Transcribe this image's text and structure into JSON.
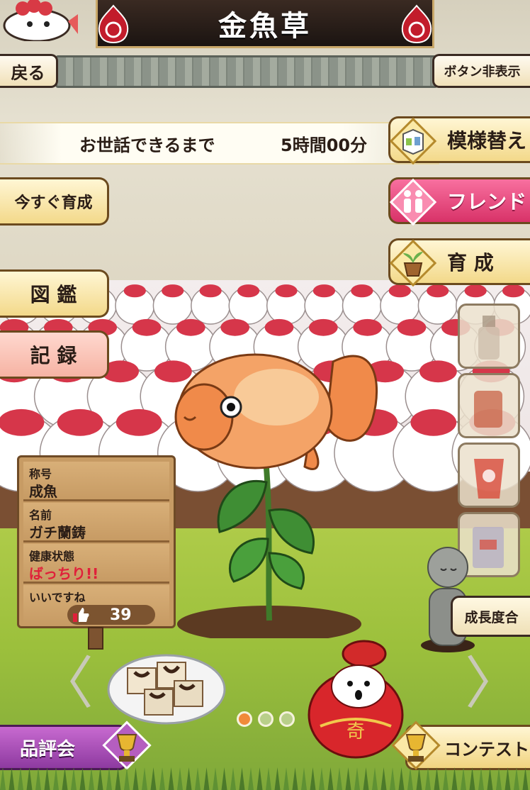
{
  "header": {
    "title": "金魚草"
  },
  "nav": {
    "back_label": "戻る",
    "hide_buttons_label": "ボタン非表示"
  },
  "timer": {
    "label": "お世話できるまで",
    "value": "5時間00分"
  },
  "right_menu": {
    "pattern_label": "模様替え",
    "friend_label": "フレンド",
    "grow_label": "育 成"
  },
  "left_menu": {
    "grow_now_label": "今すぐ育成",
    "encyclopedia_label": "図 鑑",
    "record_label": "記 録"
  },
  "growth_level_label": "成長度合",
  "info_sign": {
    "title_label": "称号",
    "title_value": "成魚",
    "name_label": "名前",
    "name_value": "ガチ蘭鋳",
    "health_label": "健康状態",
    "health_value": "ばっちり!!",
    "likes_label": "いいですね",
    "likes_count": "39"
  },
  "carousel": {
    "left_arrow": "〈",
    "right_arrow": "〉",
    "pages": 3,
    "active_page": 1
  },
  "bottom": {
    "show_label": "品評会",
    "contest_label": "コンテスト",
    "daruma_glyph": "奇"
  },
  "colors": {
    "accent_gold": "#f3d98a",
    "friend_pink": "#d83268",
    "health_red": "#e0203a",
    "show_purple": "#8e3aa0",
    "title_bar": "#1b1411"
  }
}
